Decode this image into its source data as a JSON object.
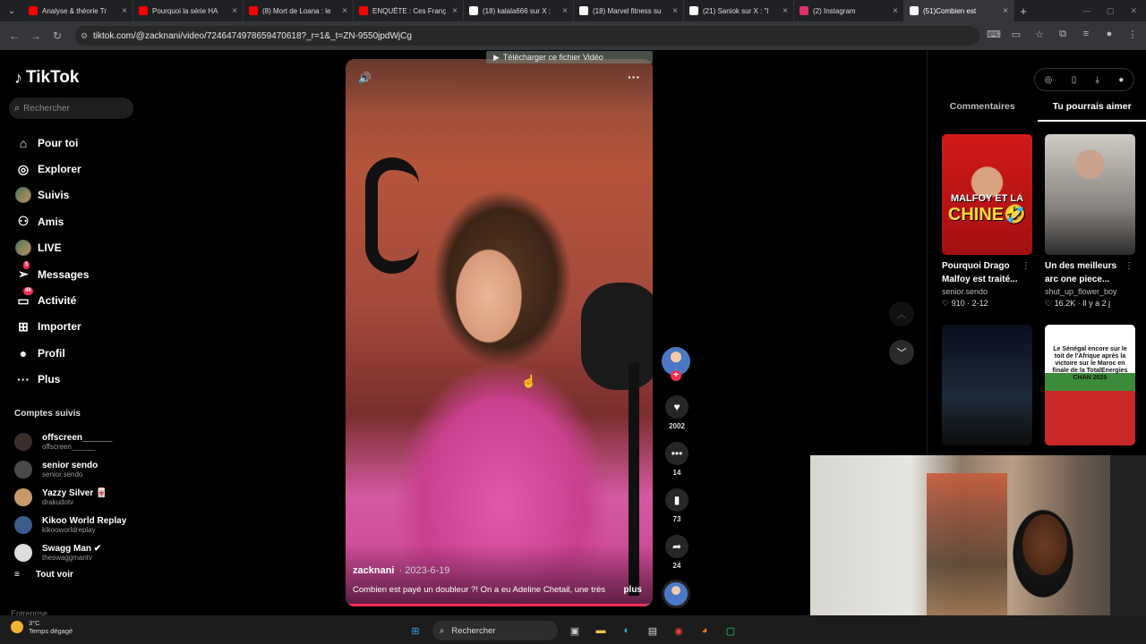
{
  "browser": {
    "tabs": [
      {
        "title": "Analyse & théorie Tr",
        "icon": "youtube-icon",
        "color": "#ff0000",
        "active": false
      },
      {
        "title": "Pourquoi la série HA",
        "icon": "youtube-icon",
        "color": "#ff0000",
        "active": false
      },
      {
        "title": "(8) Mort de Loana : le",
        "icon": "youtube-icon",
        "color": "#ff0000",
        "active": false
      },
      {
        "title": "ENQUÊTE : Ces Franç",
        "icon": "youtube-icon",
        "color": "#ff0000",
        "active": false
      },
      {
        "title": "(18) kalala666 sur X :",
        "icon": "x-icon",
        "color": "#ffffff",
        "active": false
      },
      {
        "title": "(18) Marvel fitness su",
        "icon": "x-icon",
        "color": "#ffffff",
        "active": false
      },
      {
        "title": "(21) Saniok sur X : \"l",
        "icon": "x-icon",
        "color": "#ffffff",
        "active": false
      },
      {
        "title": "(2) Instagram",
        "icon": "instagram-icon",
        "color": "#e1306c",
        "active": false
      },
      {
        "title": "(51)Combien est",
        "icon": "tiktok-icon",
        "color": "#ffffff",
        "active": true
      }
    ],
    "url": "tiktok.com/@zacknani/video/7246474978659470618?_r=1&_t=ZN-9550jpdWjCg"
  },
  "sidebar": {
    "brand": "TikTok",
    "search_placeholder": "Rechercher",
    "nav": [
      {
        "label": "Pour toi",
        "icon": "home-icon",
        "glyph": "⌂"
      },
      {
        "label": "Explorer",
        "icon": "compass-icon",
        "glyph": "◎"
      },
      {
        "label": "Suivis",
        "icon": "avatar-icon",
        "glyph": ""
      },
      {
        "label": "Amis",
        "icon": "friends-icon",
        "glyph": "⚇"
      },
      {
        "label": "LIVE",
        "icon": "live-avatar-icon",
        "glyph": ""
      },
      {
        "label": "Messages",
        "icon": "send-icon",
        "glyph": "➢",
        "badge": "5"
      },
      {
        "label": "Activité",
        "icon": "inbox-icon",
        "glyph": "▭",
        "badge": "46"
      },
      {
        "label": "Importer",
        "icon": "upload-icon",
        "glyph": "⊞"
      },
      {
        "label": "Profil",
        "icon": "profile-icon",
        "glyph": "●"
      },
      {
        "label": "Plus",
        "icon": "more-icon",
        "glyph": "···"
      }
    ],
    "followed_title": "Comptes suivis",
    "followed": [
      {
        "name": "offscreen______",
        "handle": "offscreen______"
      },
      {
        "name": "senior sendo",
        "handle": "senior.sendo"
      },
      {
        "name": "Yazzy Silver 🀄",
        "handle": "drakudotv"
      },
      {
        "name": "Kikoo World Replay",
        "handle": "kikooworldreplay"
      },
      {
        "name": "Swagg Man ✔",
        "handle": "theswaggmantv"
      }
    ],
    "see_all": "Tout voir",
    "footer": "Entreprise"
  },
  "video": {
    "download_overlay": "Télécharger ce fichier Vidéo",
    "author": "zacknani",
    "date": "· 2023-6-19",
    "caption": "Combien est payé un doubleur ?! On a eu Adeline Chetail, une très",
    "more_label": "plus",
    "progress": 0.98
  },
  "actions": {
    "likes": "2002",
    "comments": "14",
    "saves": "73",
    "shares": "24"
  },
  "right_panel": {
    "tabs": [
      "Commentaires",
      "Tu pourrais aimer"
    ],
    "active_tab": "Tu pourrais aimer",
    "cards": [
      {
        "title": "Pourquoi Drago Malfoy est traité...",
        "user": "senior.sendo",
        "meta": "♡ 910 · 2-12",
        "overlay1": "MALFOY ET LA",
        "overlay2": "CHINE🤣"
      },
      {
        "title": "Un des meilleurs arc one piece...",
        "user": "shut_up_flower_boy",
        "meta": "♡ 16.2K · Il y a 2 j",
        "overlay1": "",
        "overlay2": ""
      },
      {
        "title": "",
        "user": "",
        "meta": "",
        "overlay1": "",
        "overlay2": ""
      },
      {
        "title": "",
        "user": "",
        "meta": "",
        "overlay1": "Le Sénégal encore sur le toit de l'Afrique après la victoire sur le Maroc en finale de la TotalEnergies CHAN 2025",
        "overlay2": ""
      }
    ]
  },
  "taskbar": {
    "temp": "3°C",
    "weather": "Temps dégagé",
    "search": "Rechercher"
  }
}
